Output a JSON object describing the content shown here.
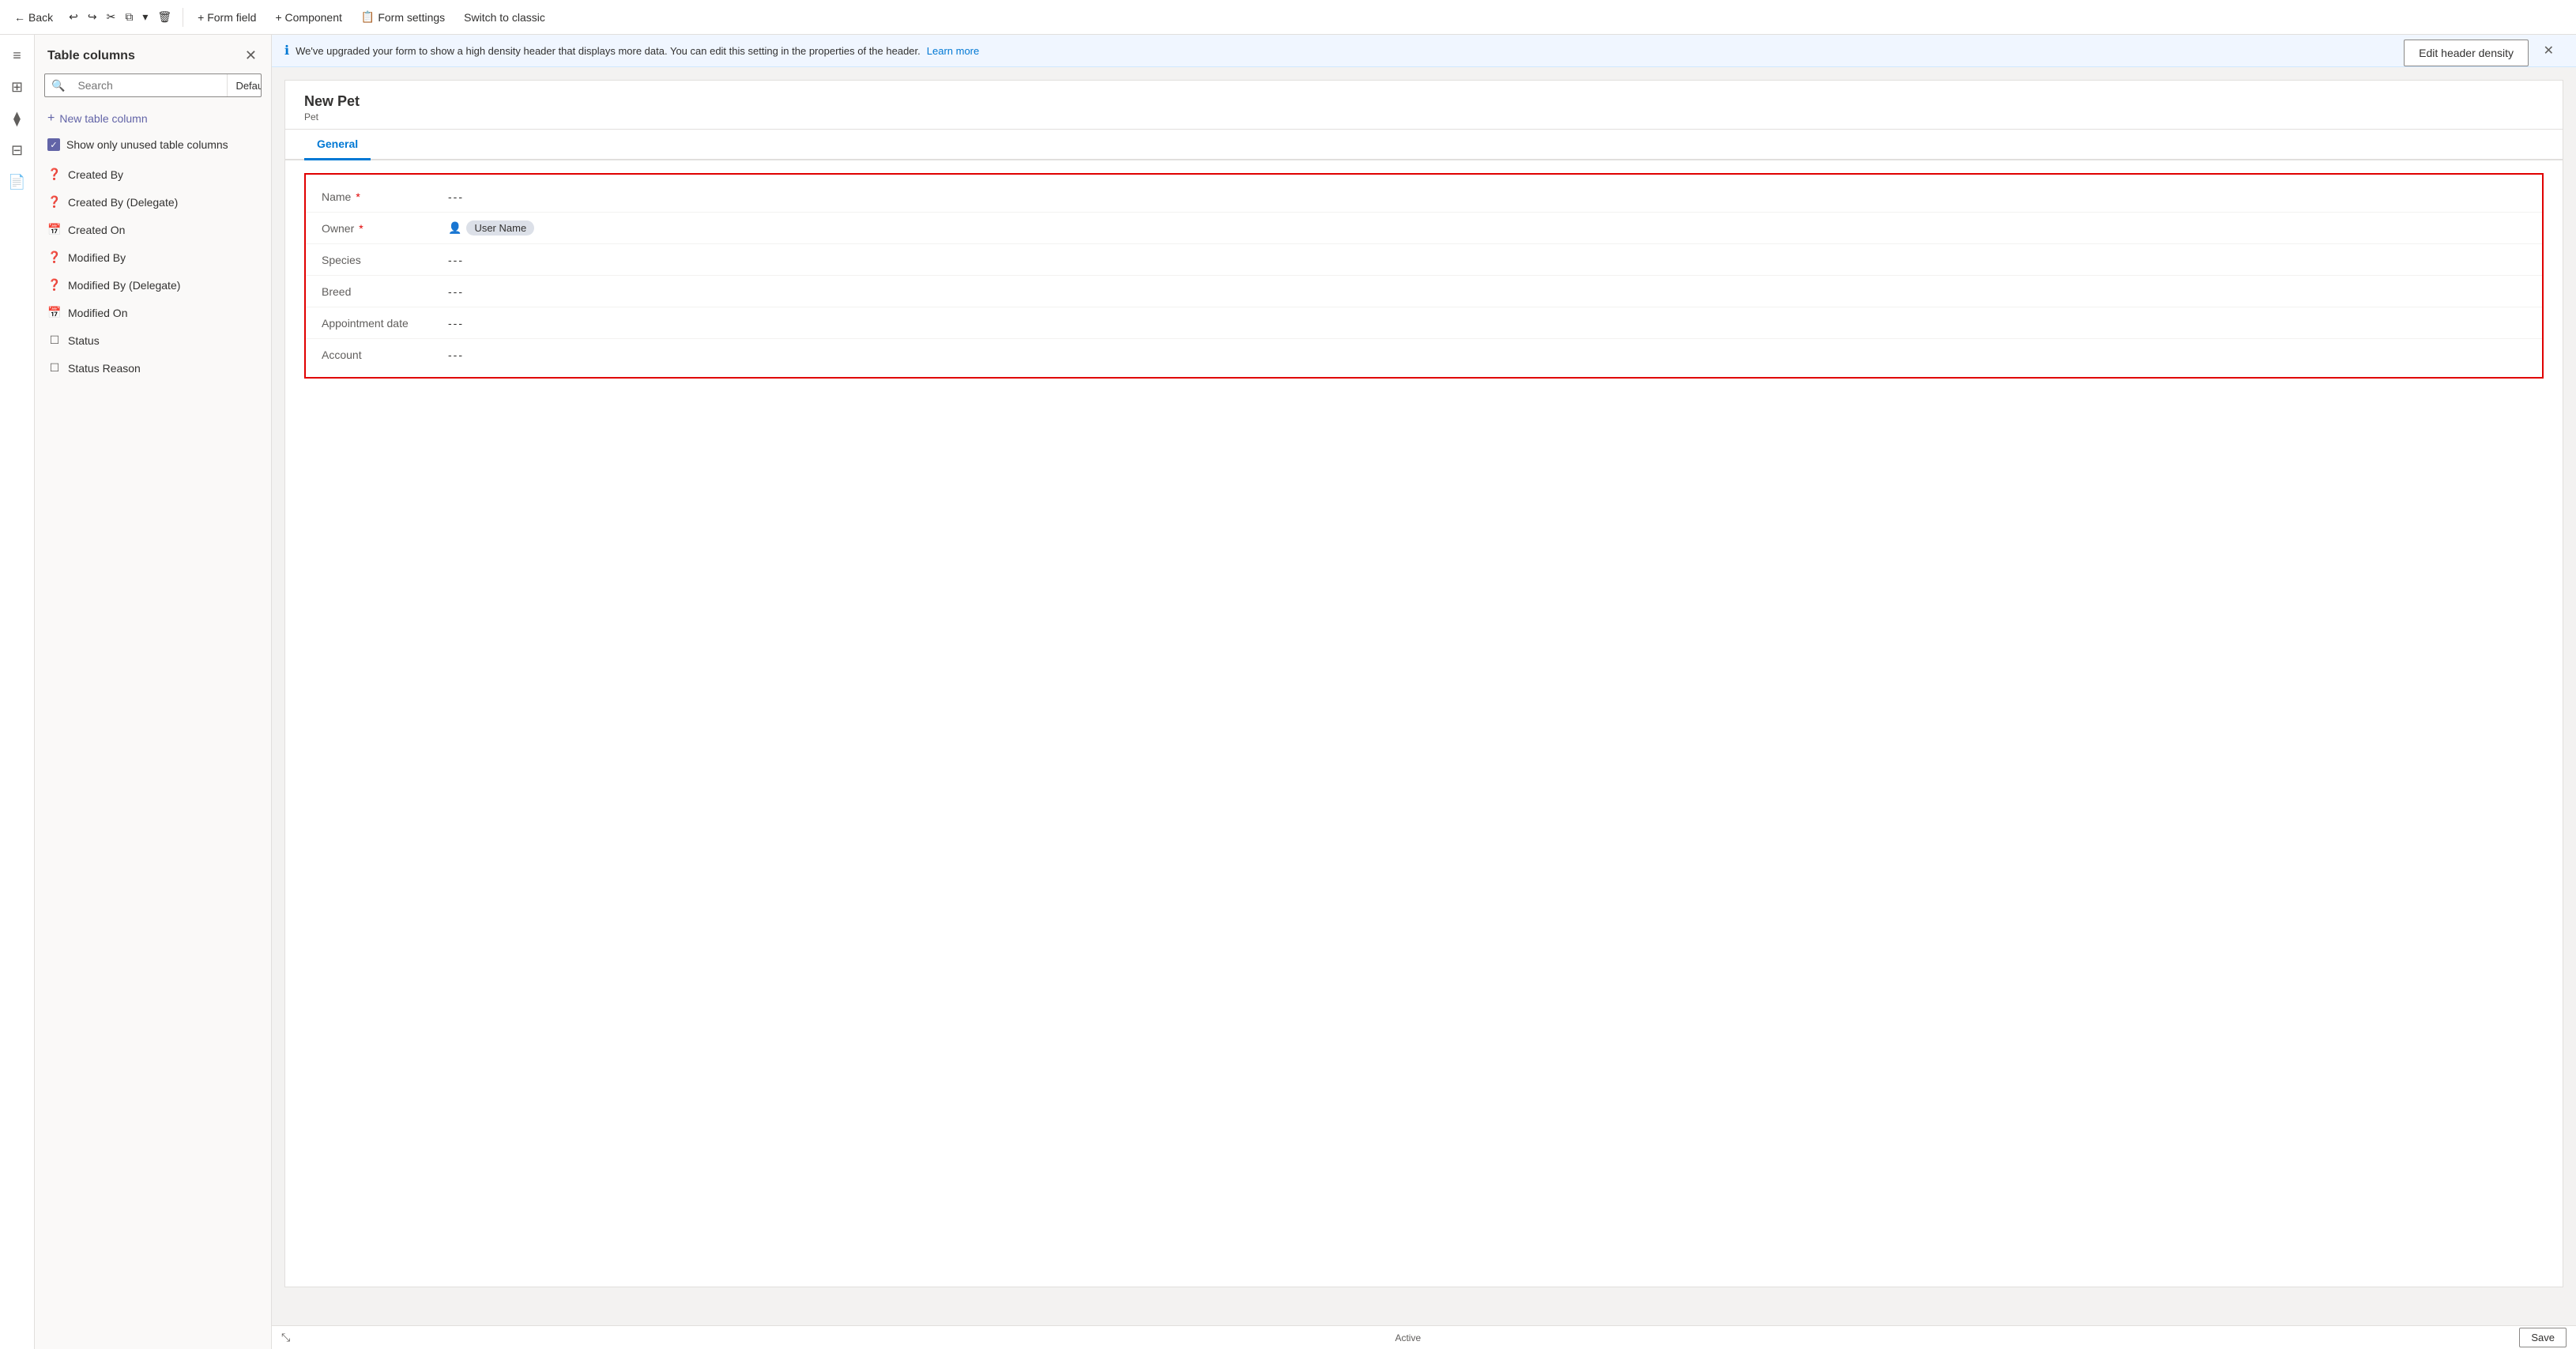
{
  "toolbar": {
    "back_label": "Back",
    "form_field_label": "+ Form field",
    "component_label": "+ Component",
    "form_settings_label": "Form settings",
    "switch_classic_label": "Switch to classic"
  },
  "sidebar": {
    "title": "Table columns",
    "search_placeholder": "Search",
    "filter_label": "Default",
    "new_table_col_label": "New table column",
    "show_unused_label": "Show only unused table columns",
    "items": [
      {
        "id": "created-by",
        "label": "Created By",
        "icon": "❓"
      },
      {
        "id": "created-by-delegate",
        "label": "Created By (Delegate)",
        "icon": "❓"
      },
      {
        "id": "created-on",
        "label": "Created On",
        "icon": "🗓"
      },
      {
        "id": "modified-by",
        "label": "Modified By",
        "icon": "❓"
      },
      {
        "id": "modified-by-delegate",
        "label": "Modified By (Delegate)",
        "icon": "❓"
      },
      {
        "id": "modified-on",
        "label": "Modified On",
        "icon": "🗓"
      },
      {
        "id": "status",
        "label": "Status",
        "icon": "☐"
      },
      {
        "id": "status-reason",
        "label": "Status Reason",
        "icon": "☐"
      }
    ]
  },
  "info_bar": {
    "message": "We've upgraded your form to show a high density header that displays more data. You can edit this setting in the properties of the header.",
    "link_label": "Learn more"
  },
  "edit_header_btn": "Edit header density",
  "form": {
    "title": "New Pet",
    "subtitle": "Pet",
    "tabs": [
      {
        "label": "General",
        "active": true
      }
    ],
    "fields": [
      {
        "label": "Name",
        "required": true,
        "value": "---",
        "type": "text"
      },
      {
        "label": "Owner",
        "required": true,
        "value": "owner_chip",
        "type": "owner"
      },
      {
        "label": "Species",
        "required": false,
        "value": "---",
        "type": "text"
      },
      {
        "label": "Breed",
        "required": false,
        "value": "---",
        "type": "text"
      },
      {
        "label": "Appointment date",
        "required": false,
        "value": "---",
        "type": "text"
      },
      {
        "label": "Account",
        "required": false,
        "value": "---",
        "type": "text"
      }
    ],
    "owner_chip_text": "User Name"
  },
  "status_bar": {
    "active_label": "Active",
    "save_label": "Save"
  },
  "icons": {
    "back": "←",
    "undo": "↩",
    "redo": "↪",
    "cut": "✂",
    "copy": "⧉",
    "more": "▾",
    "delete": "🗑",
    "hamburger": "≡",
    "layers": "⧫",
    "table": "⊞",
    "grid": "⊟",
    "pages": "📄",
    "info": "ℹ",
    "close": "✕",
    "search": "🔍",
    "chevron_down": "▾",
    "plus": "+",
    "checkbox_check": "✓",
    "person": "👤",
    "expand": "⤡"
  }
}
